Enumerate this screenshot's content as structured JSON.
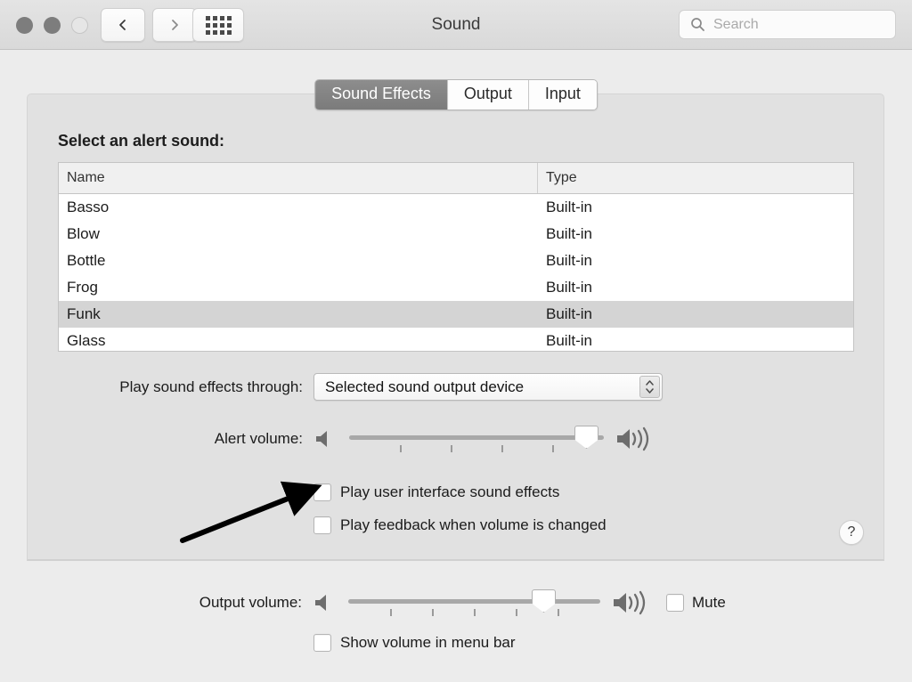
{
  "window": {
    "title": "Sound",
    "traffic_lights": [
      "close-button",
      "minimize-button",
      "zoom-button"
    ],
    "back_icon": "chevron-left-icon",
    "forward_icon": "chevron-right-icon",
    "grid_icon": "show-all-grid-icon"
  },
  "search": {
    "placeholder": "Search",
    "value": "",
    "icon": "search-icon"
  },
  "tabs": [
    {
      "label": "Sound Effects",
      "selected": true
    },
    {
      "label": "Output",
      "selected": false
    },
    {
      "label": "Input",
      "selected": false
    }
  ],
  "panel": {
    "section_label": "Select an alert sound:",
    "table": {
      "columns": [
        "Name",
        "Type"
      ],
      "rows": [
        {
          "name": "Basso",
          "type": "Built-in",
          "selected": false
        },
        {
          "name": "Blow",
          "type": "Built-in",
          "selected": false
        },
        {
          "name": "Bottle",
          "type": "Built-in",
          "selected": false
        },
        {
          "name": "Frog",
          "type": "Built-in",
          "selected": false
        },
        {
          "name": "Funk",
          "type": "Built-in",
          "selected": true
        },
        {
          "name": "Glass",
          "type": "Built-in",
          "selected": false
        }
      ]
    },
    "play_through": {
      "label": "Play sound effects through:",
      "value": "Selected sound output device",
      "arrows_icon": "updown-chevron-icon"
    },
    "alert_volume": {
      "label": "Alert volume:",
      "value_percent": 93,
      "low_icon": "speaker-low-icon",
      "high_icon": "speaker-high-icon",
      "tick_count": 4
    },
    "checkboxes": [
      {
        "label": "Play user interface sound effects",
        "checked": false
      },
      {
        "label": "Play feedback when volume is changed",
        "checked": false
      }
    ],
    "help_label": "?"
  },
  "footer": {
    "output_volume": {
      "label": "Output volume:",
      "value_percent": 78,
      "low_icon": "speaker-low-icon",
      "high_icon": "speaker-high-icon",
      "tick_count": 5
    },
    "mute": {
      "label": "Mute",
      "checked": false
    },
    "show_in_menu_bar": {
      "label": "Show volume in menu bar",
      "checked": false
    }
  },
  "annotation": {
    "type": "arrow",
    "points_to": "Play user interface sound effects checkbox",
    "color": "#000000"
  },
  "colors": {
    "window_bg": "#ececec",
    "panel_bg": "#e1e1e1",
    "titlebar_bg": "#dedede",
    "tab_active_bg": "#828282",
    "row_selected_bg": "#d4d4d4"
  }
}
